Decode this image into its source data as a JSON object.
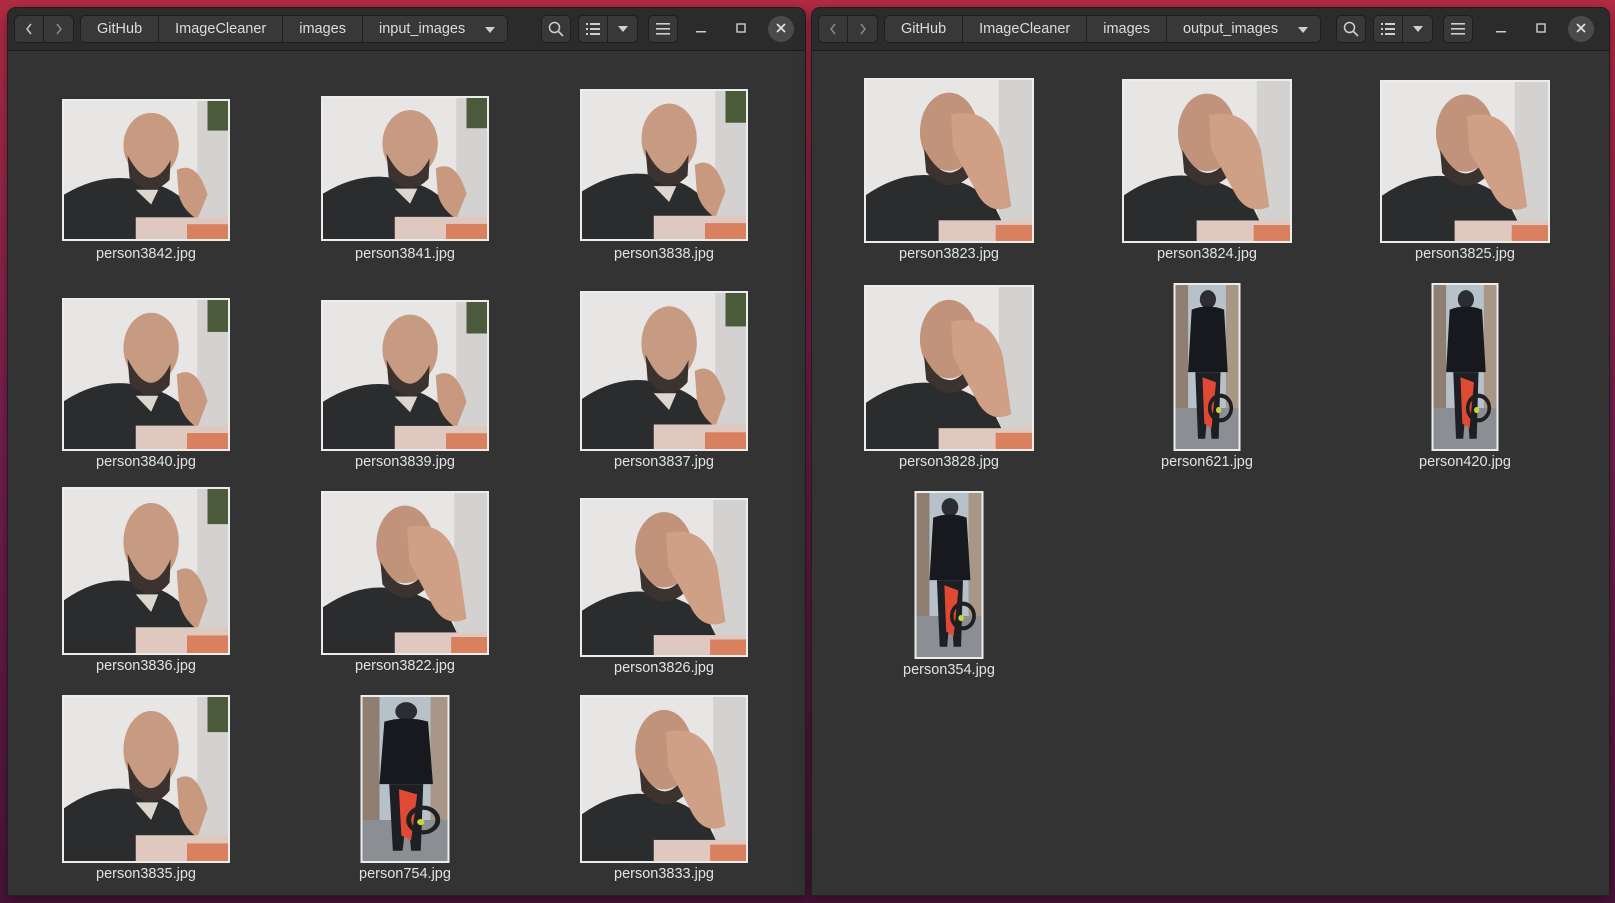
{
  "left": {
    "breadcrumbs": [
      "GitHub",
      "ImageCleaner",
      "images"
    ],
    "current_folder": "input_images",
    "files": [
      {
        "name": "person3842.jpg",
        "kind": "face"
      },
      {
        "name": "person3841.jpg",
        "kind": "face"
      },
      {
        "name": "person3838.jpg",
        "kind": "face"
      },
      {
        "name": "person3840.jpg",
        "kind": "face"
      },
      {
        "name": "person3839.jpg",
        "kind": "face"
      },
      {
        "name": "person3837.jpg",
        "kind": "face"
      },
      {
        "name": "person3836.jpg",
        "kind": "face"
      },
      {
        "name": "person3822.jpg",
        "kind": "facepalm"
      },
      {
        "name": "person3826.jpg",
        "kind": "facepalm"
      },
      {
        "name": "person3835.jpg",
        "kind": "face"
      },
      {
        "name": "person754.jpg",
        "kind": "bike"
      },
      {
        "name": "person3833.jpg",
        "kind": "facepalm"
      }
    ]
  },
  "right": {
    "breadcrumbs": [
      "GitHub",
      "ImageCleaner",
      "images"
    ],
    "current_folder": "output_images",
    "files": [
      {
        "name": "person3823.jpg",
        "kind": "facepalm"
      },
      {
        "name": "person3824.jpg",
        "kind": "facepalm"
      },
      {
        "name": "person3825.jpg",
        "kind": "facepalm"
      },
      {
        "name": "person3828.jpg",
        "kind": "facepalm"
      },
      {
        "name": "person621.jpg",
        "kind": "bike"
      },
      {
        "name": "person420.jpg",
        "kind": "bike"
      },
      {
        "name": "person354.jpg",
        "kind": "bike"
      }
    ]
  },
  "icons": {
    "back": "chevron-left-icon",
    "forward": "chevron-right-icon",
    "folder_menu": "caret-down-icon",
    "search": "search-icon",
    "view_list": "list-view-icon",
    "view_options": "caret-down-icon",
    "menu": "hamburger-icon",
    "minimize": "minimize-icon",
    "maximize": "maximize-icon",
    "close": "close-icon"
  }
}
